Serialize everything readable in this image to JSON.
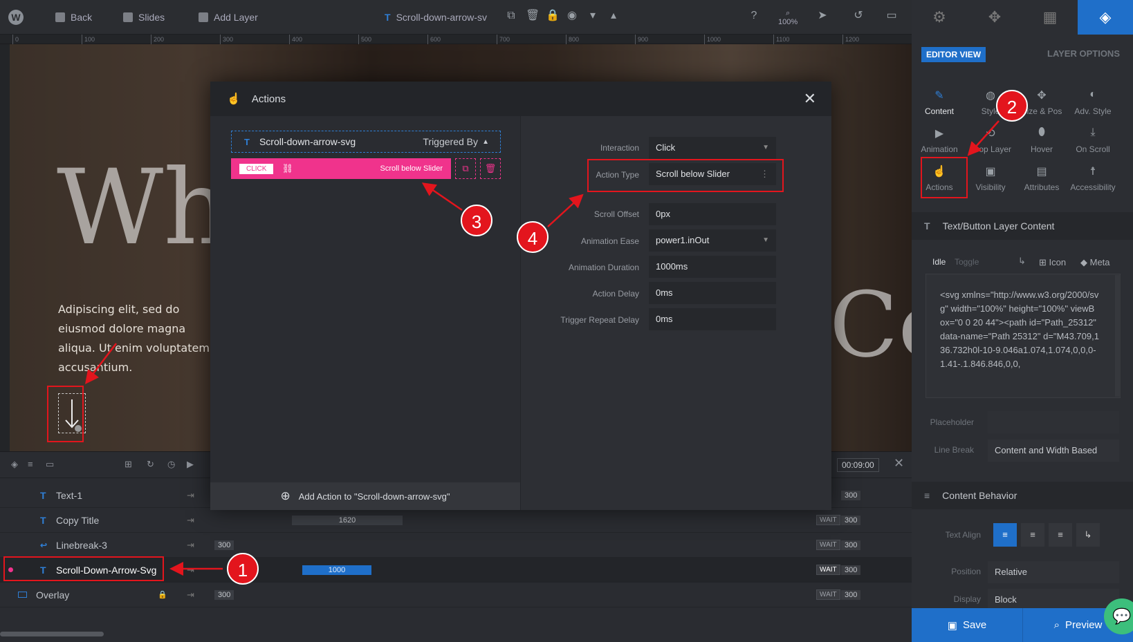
{
  "topbar": {
    "back": "Back",
    "slides": "Slides",
    "add_layer": "Add Layer",
    "layer_name": "Scroll-down-arrow-sv",
    "zoom": "100%"
  },
  "ruler": {
    "ticks": [
      "0",
      "100",
      "200",
      "300",
      "400",
      "500",
      "600",
      "700",
      "800",
      "900",
      "1000",
      "1100",
      "1200"
    ]
  },
  "canvas": {
    "heading": "Wh",
    "heading_right": "Co",
    "paragraph": "Adipiscing elit, sed do eiusmod dolore magna aliqua. Ut enim voluptatem accusantium."
  },
  "timeline": {
    "time": "00:09:00",
    "rows": [
      {
        "name": "Text-1",
        "badge": "",
        "wait": "",
        "value": "300"
      },
      {
        "name": "Copy Title",
        "badge": "1620",
        "wait": "WAIT",
        "value": "300"
      },
      {
        "name": "Linebreak-3",
        "badge": "300",
        "wait": "WAIT",
        "value": "300"
      },
      {
        "name": "Scroll-Down-Arrow-Svg",
        "badge": "1000",
        "wait": "WAIT",
        "value": "300"
      },
      {
        "name": "Overlay",
        "badge": "300",
        "wait": "WAIT",
        "value": "300"
      }
    ]
  },
  "modal": {
    "title": "Actions",
    "layer": "Scroll-down-arrow-svg",
    "triggered_by": "Triggered By",
    "action_tag": "CLICK",
    "action_label": "Scroll below Slider",
    "add_action": "Add Action to \"Scroll-down-arrow-svg\"",
    "fields": [
      {
        "label": "Interaction",
        "value": "Click"
      },
      {
        "label": "Action Type",
        "value": "Scroll below Slider"
      },
      {
        "label": "Scroll Offset",
        "value": "0px"
      },
      {
        "label": "Animation Ease",
        "value": "power1.inOut"
      },
      {
        "label": "Animation Duration",
        "value": "1000ms"
      },
      {
        "label": "Action Delay",
        "value": "0ms"
      },
      {
        "label": "Trigger Repeat Delay",
        "value": "0ms"
      }
    ]
  },
  "rpanel": {
    "editor_view": "EDITOR VIEW",
    "layer_options": "LAYER OPTIONS",
    "grid": [
      "Content",
      "Style",
      "Size & Pos",
      "Adv. Style",
      "Animation",
      "Loop Layer",
      "Hover",
      "On Scroll",
      "Actions",
      "Visibility",
      "Attributes",
      "Accessibility"
    ],
    "section_content": "Text/Button Layer Content",
    "tabs": {
      "idle": "Idle",
      "toggle": "Toggle",
      "icon": "Icon",
      "meta": "Meta"
    },
    "code": "<svg xmlns=\"http://www.w3.org/2000/svg\" width=\"100%\" height=\"100%\" viewBox=\"0 0 20 44\"><path id=\"Path_25312\" data-name=\"Path 25312\" d=\"M43.709,136.732h0l-10-9.046a1.074,1.074,0,0,0-1.41-.1.846.846,0,0,",
    "placeholder": "Placeholder",
    "line_break_label": "Line Break",
    "line_break_value": "Content and Width Based",
    "section_behavior": "Content Behavior",
    "text_align": "Text Align",
    "position_label": "Position",
    "position_value": "Relative",
    "display_label": "Display",
    "display_value": "Block",
    "save": "Save",
    "preview": "Preview"
  },
  "annotations": {
    "n1": "1",
    "n2": "2",
    "n3": "3",
    "n4": "4"
  },
  "colors": {
    "accent_pink": "#f0338c",
    "accent_blue": "#1f6fc9",
    "annotation_red": "#e3151d"
  }
}
